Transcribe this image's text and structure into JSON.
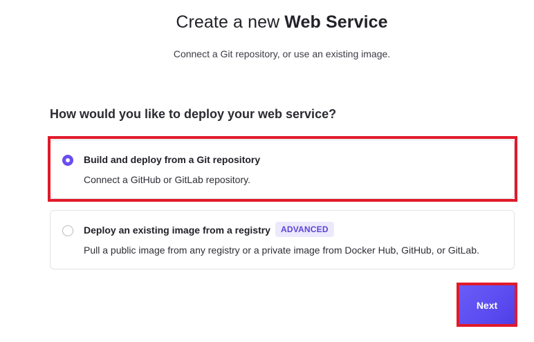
{
  "header": {
    "title_prefix": "Create a new ",
    "title_bold": "Web Service",
    "subtitle": "Connect a Git repository, or use an existing image."
  },
  "question": "How would you like to deploy your web service?",
  "options": [
    {
      "title": "Build and deploy from a Git repository",
      "description": "Connect a GitHub or GitLab repository.",
      "selected": true
    },
    {
      "title": "Deploy an existing image from a registry",
      "badge": "ADVANCED",
      "description": "Pull a public image from any registry or a private image from Docker Hub, GitHub, or GitLab.",
      "selected": false
    }
  ],
  "actions": {
    "next_label": "Next"
  },
  "colors": {
    "accent": "#6a4df0",
    "highlight": "#e01a2b",
    "badge_bg": "#ece9fd",
    "badge_text": "#5a44d6",
    "button_bg": "#5b4cf0"
  }
}
